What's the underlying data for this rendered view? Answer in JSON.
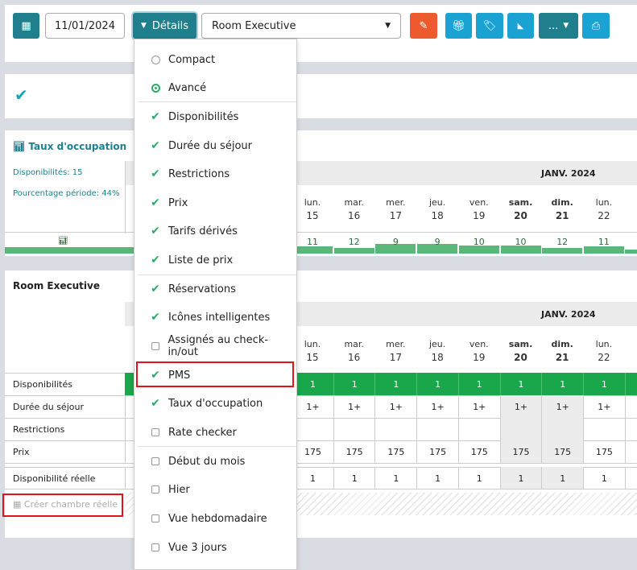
{
  "toolbar": {
    "date": "11/01/2024",
    "details_label": "Détails",
    "room_select": "Room Executive",
    "more_label": "..."
  },
  "menu": {
    "items": [
      {
        "label": "Compact",
        "type": "radio",
        "checked": false
      },
      {
        "label": "Avancé",
        "type": "radio",
        "checked": true
      },
      {
        "label": "Disponibilités",
        "type": "check",
        "checked": true
      },
      {
        "label": "Durée du séjour",
        "type": "check",
        "checked": true
      },
      {
        "label": "Restrictions",
        "type": "check",
        "checked": true
      },
      {
        "label": "Prix",
        "type": "check",
        "checked": true
      },
      {
        "label": "Tarifs dérivés",
        "type": "check",
        "checked": true
      },
      {
        "label": "Liste de prix",
        "type": "check",
        "checked": true
      },
      {
        "label": "Réservations",
        "type": "check",
        "checked": true
      },
      {
        "label": "Icônes intelligentes",
        "type": "check",
        "checked": true
      },
      {
        "label": "Assignés au check-in/out",
        "type": "check",
        "checked": false
      },
      {
        "label": "PMS",
        "type": "check",
        "checked": true
      },
      {
        "label": "Taux d'occupation",
        "type": "check",
        "checked": true
      },
      {
        "label": "Rate checker",
        "type": "check",
        "checked": false
      },
      {
        "label": "Début du mois",
        "type": "check",
        "checked": false
      },
      {
        "label": "Hier",
        "type": "check",
        "checked": false
      },
      {
        "label": "Vue hebdomadaire",
        "type": "check",
        "checked": false
      },
      {
        "label": "Vue 3 jours",
        "type": "check",
        "checked": false
      }
    ]
  },
  "occupancy": {
    "title": "Taux d'occupation",
    "availability": "Disponibilités: 15",
    "percentage": "Pourcentage période: 44%",
    "month": "JANV. 2024",
    "counts": [
      "11",
      "12",
      "9",
      "9",
      "10",
      "10",
      "12",
      "11"
    ]
  },
  "days": [
    {
      "dow": "lun.",
      "num": "15",
      "weekend": false
    },
    {
      "dow": "mar.",
      "num": "16",
      "weekend": false
    },
    {
      "dow": "mer.",
      "num": "17",
      "weekend": false
    },
    {
      "dow": "jeu.",
      "num": "18",
      "weekend": false
    },
    {
      "dow": "ven.",
      "num": "19",
      "weekend": false
    },
    {
      "dow": "sam.",
      "num": "20",
      "weekend": true
    },
    {
      "dow": "dim.",
      "num": "21",
      "weekend": true
    },
    {
      "dow": "lun.",
      "num": "22",
      "weekend": false
    }
  ],
  "room": {
    "title": "Room Executive",
    "month": "JANV. 2024",
    "create_label": "Créer chambre réelle",
    "rows": [
      {
        "label": "Disponibilités",
        "values": [
          "1",
          "1",
          "1",
          "1",
          "1",
          "1",
          "1",
          "1"
        ]
      },
      {
        "label": "Durée du séjour",
        "values": [
          "1+",
          "1+",
          "1+",
          "1+",
          "1+",
          "1+",
          "1+",
          "1+"
        ]
      },
      {
        "label": "Restrictions",
        "values": [
          "",
          "",
          "",
          "",
          "",
          "",
          "",
          ""
        ]
      },
      {
        "label": "Prix",
        "values": [
          "175",
          "175",
          "175",
          "175",
          "175",
          "175",
          "175",
          "175"
        ]
      },
      {
        "label": "Disponibilité réelle",
        "values": [
          "1",
          "1",
          "1",
          "1",
          "1",
          "1",
          "1",
          "1"
        ]
      }
    ]
  },
  "colors": {
    "teal": "#1f7f8c",
    "blue": "#1aa3d2",
    "orange": "#ec5a2e",
    "green": "#1aa64a",
    "bar": "#5bb67a"
  }
}
